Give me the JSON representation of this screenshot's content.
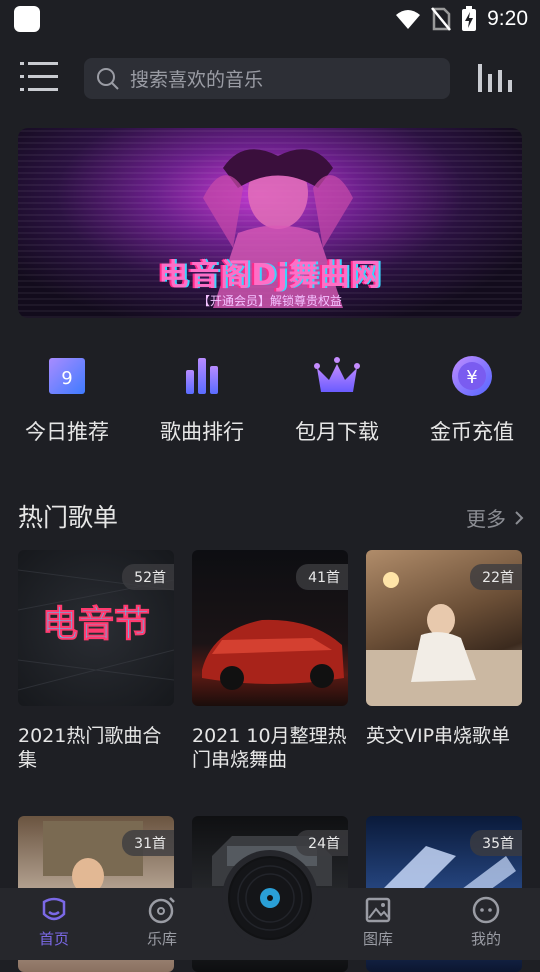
{
  "status": {
    "time": "9:20"
  },
  "search": {
    "placeholder": "搜索喜欢的音乐"
  },
  "banner": {
    "title": "电音阁Dj舞曲网",
    "subtitle": "【开通会员】解锁尊贵权益"
  },
  "quick_nav": [
    {
      "label": "今日推荐",
      "icon": "calendar-9-icon",
      "badge": "9"
    },
    {
      "label": "歌曲排行",
      "icon": "bar-chart-icon"
    },
    {
      "label": "包月下载",
      "icon": "crown-icon"
    },
    {
      "label": "金币充值",
      "icon": "yen-coin-icon",
      "symbol": "¥"
    }
  ],
  "section": {
    "title": "热门歌单",
    "more": "更多"
  },
  "playlists": [
    {
      "count": "52首",
      "title": "2021热门歌曲合集",
      "cover_text": "电音节"
    },
    {
      "count": "41首",
      "title": "2021 10月整理热门串烧舞曲"
    },
    {
      "count": "22首",
      "title": "英文VIP串烧歌单"
    },
    {
      "count": "31首",
      "title": ""
    },
    {
      "count": "24首",
      "title": ""
    },
    {
      "count": "35首",
      "title": ""
    }
  ],
  "bottom_nav": [
    {
      "label": "首页",
      "active": true
    },
    {
      "label": "乐库",
      "active": false
    },
    {
      "label": "图库",
      "active": false
    },
    {
      "label": "我的",
      "active": false
    }
  ],
  "colors": {
    "accent": "#7b69e6",
    "background": "#1e1f24"
  }
}
